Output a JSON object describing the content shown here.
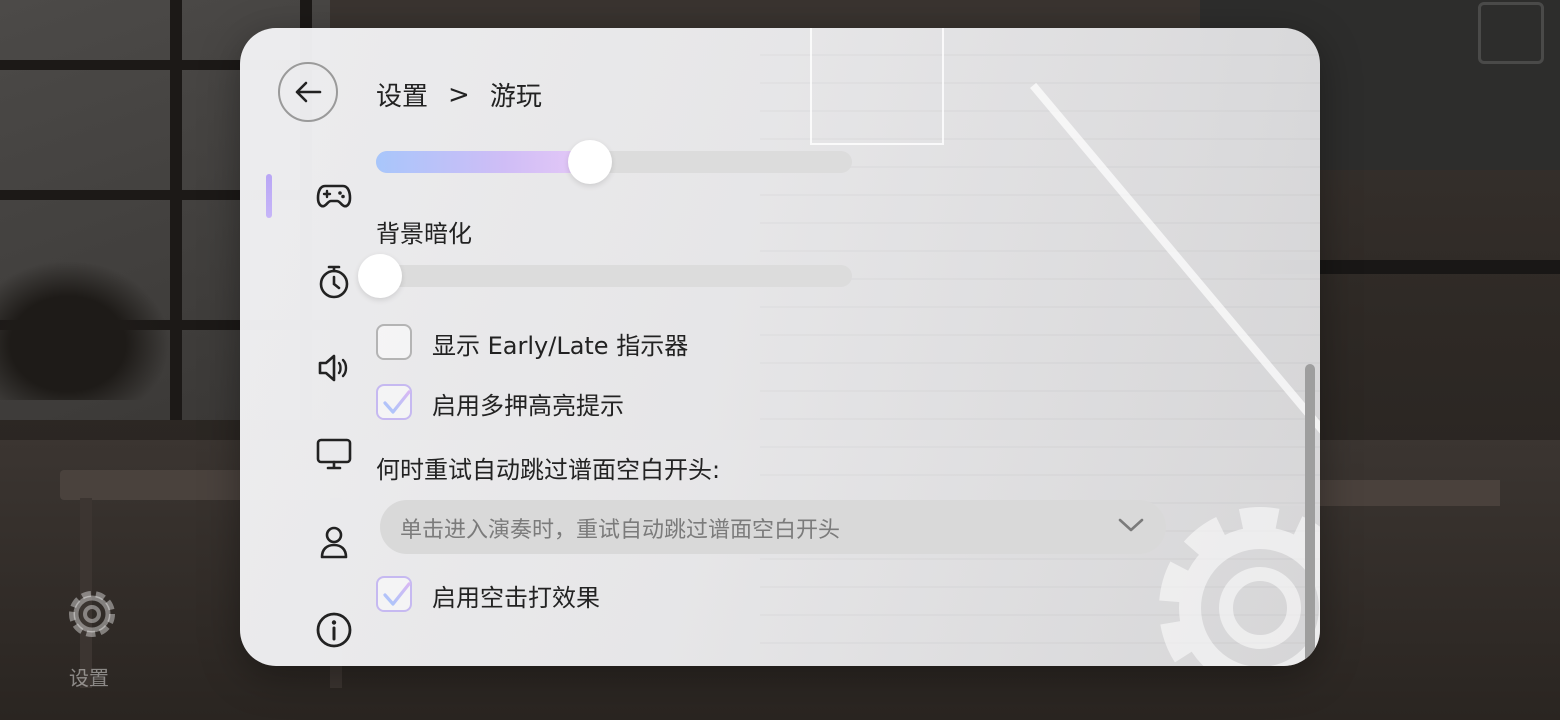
{
  "background": {
    "settings_label": "设置"
  },
  "header": {
    "breadcrumb_root": "设置",
    "breadcrumb_separator": ">",
    "breadcrumb_current": "游玩"
  },
  "nav": {
    "items": [
      {
        "icon": "gamepad-icon",
        "active": true
      },
      {
        "icon": "stopwatch-icon",
        "active": false
      },
      {
        "icon": "speaker-icon",
        "active": false
      },
      {
        "icon": "monitor-icon",
        "active": false
      },
      {
        "icon": "user-icon",
        "active": false
      },
      {
        "icon": "info-icon",
        "active": false
      }
    ]
  },
  "settings": {
    "top_slider_value": 0.45,
    "background_dim": {
      "label": "背景暗化",
      "value": 0.0
    },
    "early_late": {
      "label": "显示 Early/Late 指示器",
      "checked": false
    },
    "multi_press": {
      "label": "启用多押高亮提示",
      "checked": true
    },
    "retry_skip": {
      "label": "何时重试自动跳过谱面空白开头:",
      "selected": "单击进入演奏时，重试自动跳过谱面空白开头"
    },
    "empty_hit": {
      "label": "启用空击打效果",
      "checked": true
    }
  },
  "colors": {
    "accent_start": "#a8c6fb",
    "accent_end": "#e6c9f7",
    "indicator": "#b9a6f5"
  }
}
